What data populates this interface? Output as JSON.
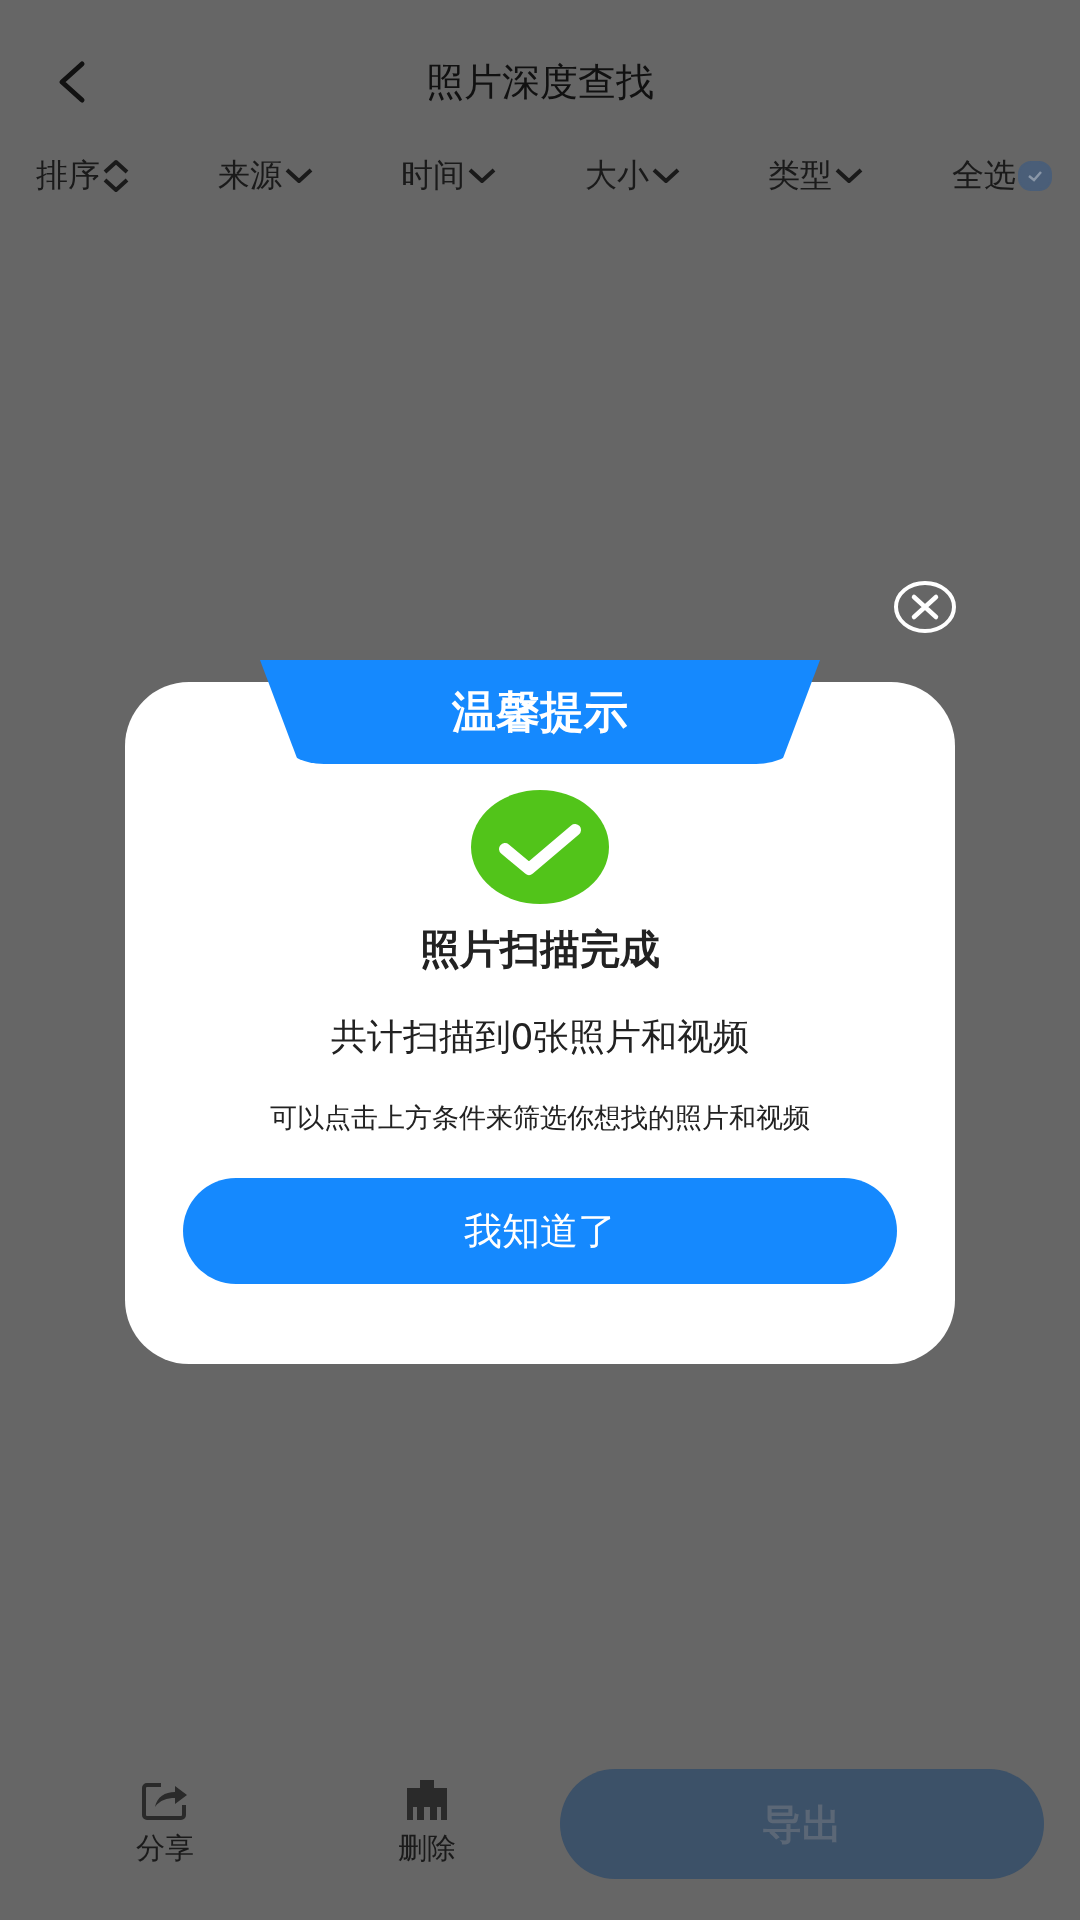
{
  "header": {
    "title": "照片深度查找"
  },
  "filters": [
    {
      "label": "排序",
      "kind": "sort"
    },
    {
      "label": "来源",
      "kind": "dropdown"
    },
    {
      "label": "时间",
      "kind": "dropdown"
    },
    {
      "label": "大小",
      "kind": "dropdown"
    },
    {
      "label": "类型",
      "kind": "dropdown"
    },
    {
      "label": "全选",
      "kind": "checkbox",
      "checked": true
    }
  ],
  "dialog": {
    "banner": "温馨提示",
    "title": "照片扫描完成",
    "summary": "共计扫描到0张照片和视频",
    "hint": "可以点击上方条件来筛选你想找的照片和视频",
    "button": "我知道了"
  },
  "bottom_bar": {
    "actions": [
      {
        "label": "分享",
        "kind": "share"
      },
      {
        "label": "删除",
        "kind": "delete"
      }
    ],
    "export_button": "导出"
  }
}
